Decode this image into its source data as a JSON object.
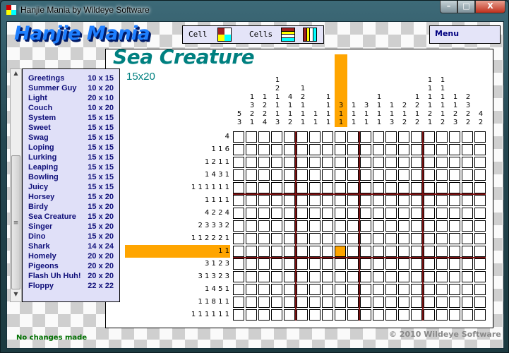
{
  "window": {
    "title": "Hanjie Mania by Wildeye Software",
    "min": "–",
    "max": "□",
    "close": "X"
  },
  "header": {
    "logo": "Hanjie Mania",
    "cell_label": "Cell",
    "cells_label": "Cells",
    "menu_label": "Menu",
    "colors": {
      "filled": "#a02020",
      "marked": "#ffff00",
      "empty": "#ffffff",
      "cross": "#00ffff"
    }
  },
  "puzzle": {
    "title": "Sea Creature",
    "size": "15x20",
    "selected": {
      "row": 10,
      "col": 9
    },
    "highlight_color": "#ffa500",
    "col_clues": [
      [
        5,
        3
      ],
      [
        1,
        3,
        2,
        1
      ],
      [
        1,
        2,
        2,
        4
      ],
      [
        1,
        2,
        1,
        1,
        1,
        3
      ],
      [
        4,
        1,
        1,
        2
      ],
      [
        1,
        2,
        1,
        1,
        1
      ],
      [
        1,
        1
      ],
      [
        1,
        1,
        1,
        1
      ],
      [
        3,
        1,
        1
      ],
      [
        1,
        1,
        1
      ],
      [
        3,
        1,
        1
      ],
      [
        1,
        1,
        1,
        1
      ],
      [
        1,
        1,
        3
      ],
      [
        2,
        1,
        2
      ],
      [
        1,
        2,
        1,
        2
      ],
      [
        1,
        1,
        1,
        1,
        2,
        1
      ],
      [
        1,
        1,
        1,
        1,
        1,
        2
      ],
      [
        1,
        1,
        2,
        3
      ],
      [
        2,
        3,
        2,
        2
      ],
      [
        4,
        2
      ]
    ],
    "row_clues": [
      "4",
      "1 1 6",
      "1 2 1 1",
      "1 4 3 1",
      "1 1 1 1 1 1",
      "1 1 1 1",
      "4 2 2 4",
      "2 3 3 3 2",
      "1 1 2 2 2 1",
      "1 1",
      "3 1 2 3",
      "3 1 3 2 3",
      "1 4 5 1",
      "1 1 8 1 1",
      "1 1 1 1 1 1"
    ]
  },
  "puzzle_list": [
    {
      "name": "Greetings",
      "size": "10 x 15"
    },
    {
      "name": "Summer Guy",
      "size": "10 x 20"
    },
    {
      "name": "Light",
      "size": "20 x 10"
    },
    {
      "name": "Couch",
      "size": "10 x 20"
    },
    {
      "name": "System",
      "size": "15 x 15"
    },
    {
      "name": "Sweet",
      "size": "15 x 15"
    },
    {
      "name": "Swag",
      "size": "15 x 15"
    },
    {
      "name": "Loping",
      "size": "15 x 15"
    },
    {
      "name": "Lurking",
      "size": "15 x 15"
    },
    {
      "name": "Leaping",
      "size": "15 x 15"
    },
    {
      "name": "Bowling",
      "size": "15 x 15"
    },
    {
      "name": "Juicy",
      "size": "15 x 15"
    },
    {
      "name": "Horsey",
      "size": "15 x 20"
    },
    {
      "name": "Birdy",
      "size": "15 x 20"
    },
    {
      "name": "Sea Creature",
      "size": "15 x 20"
    },
    {
      "name": "Singer",
      "size": "15 x 20"
    },
    {
      "name": "Dino",
      "size": "15 x 20"
    },
    {
      "name": "Shark",
      "size": "14 x 24"
    },
    {
      "name": "Homely",
      "size": "20 x 20"
    },
    {
      "name": "Pigeons",
      "size": "20 x 20"
    },
    {
      "name": "Flash Uh Huh!",
      "size": "20 x 20"
    },
    {
      "name": "Floppy",
      "size": "22 x 22"
    }
  ],
  "status": "No changes made",
  "copyright": "© 2010 Wildeye Software"
}
